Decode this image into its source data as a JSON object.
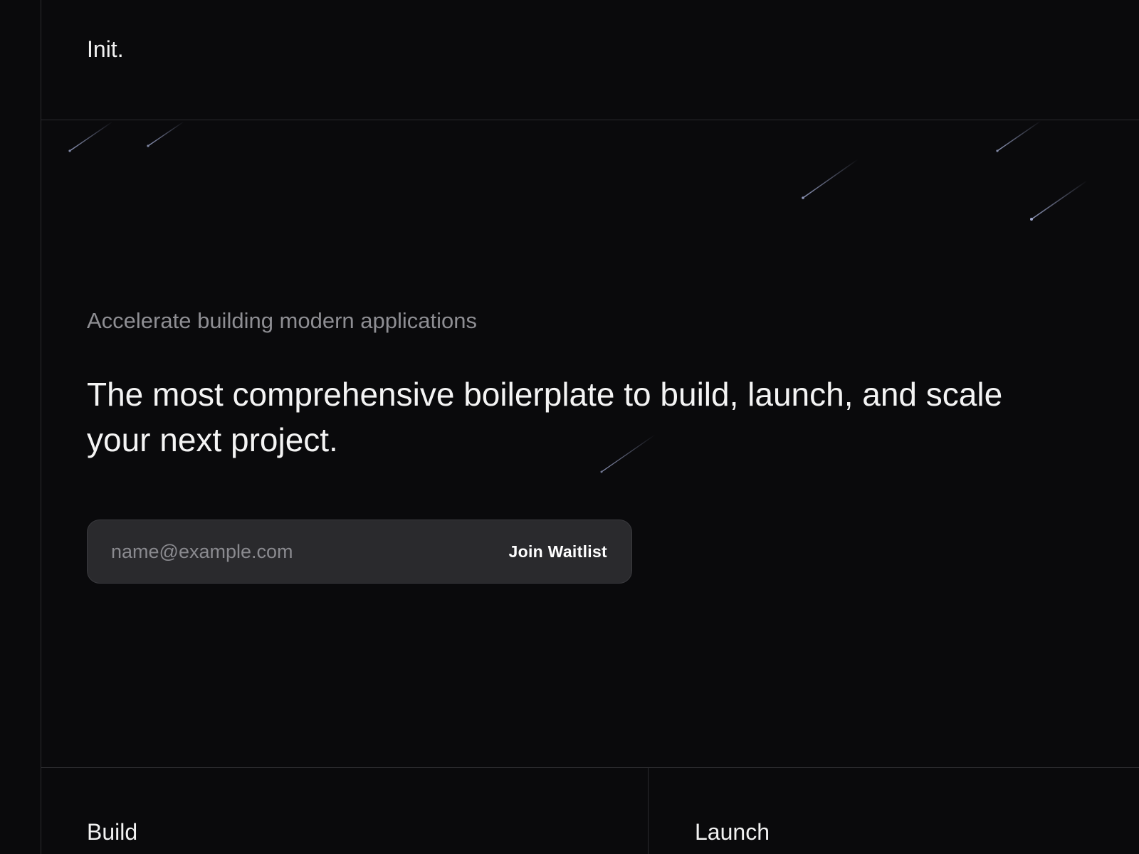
{
  "header": {
    "brand": "Init."
  },
  "hero": {
    "eyebrow": "Accelerate building modern applications",
    "headline": "The most comprehensive boilerplate to build, launch, and scale your next project.",
    "waitlist": {
      "email_placeholder": "name@example.com",
      "email_value": "",
      "button_label": "Join Waitlist"
    }
  },
  "features": {
    "columns": [
      {
        "title": "Build"
      },
      {
        "title": "Launch"
      }
    ]
  },
  "colors": {
    "background": "#0a0a0c",
    "divider": "#2a2a2e",
    "input_bg": "#2a2a2d",
    "text_primary": "#f4f4f4",
    "text_muted": "#8e8e93"
  }
}
